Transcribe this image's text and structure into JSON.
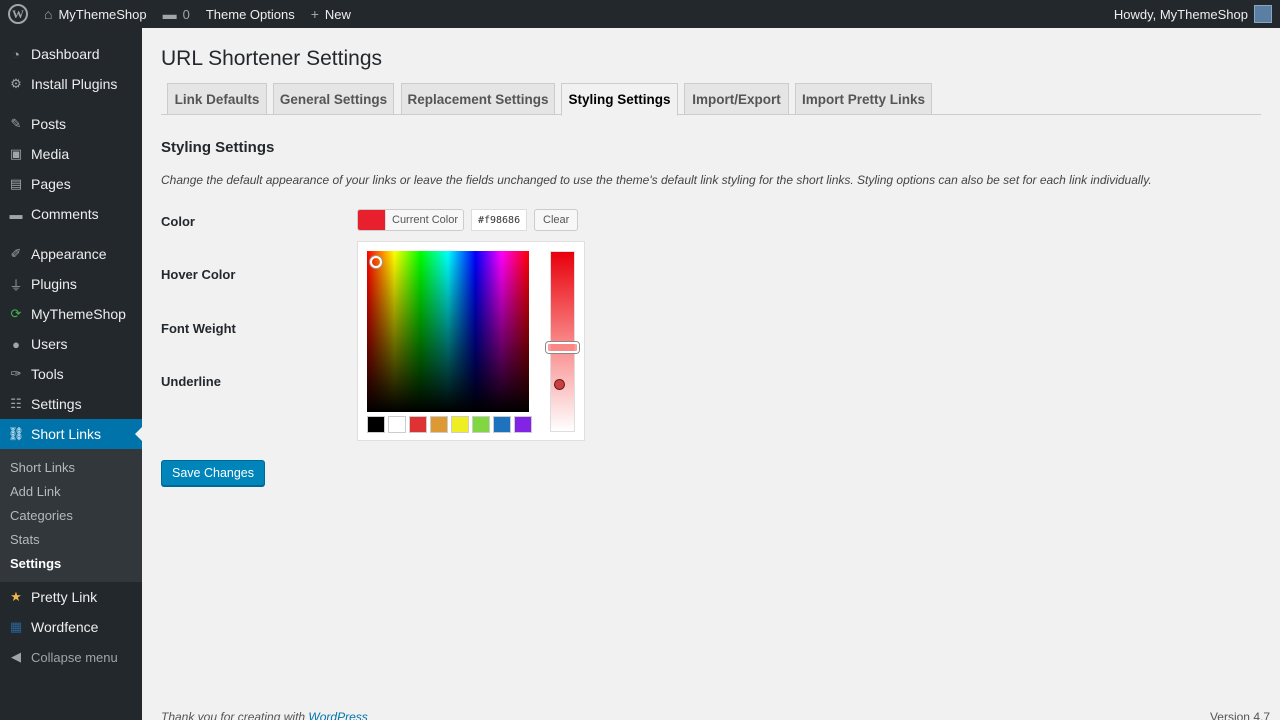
{
  "adminbar": {
    "site_name": "MyThemeShop",
    "comments_count": "0",
    "theme_options": "Theme Options",
    "new_label": "New",
    "howdy": "Howdy, MyThemeShop"
  },
  "sidebar": {
    "items": [
      {
        "label": "Dashboard",
        "icon": "dashboard-icon",
        "glyph": "◔"
      },
      {
        "label": "Install Plugins",
        "icon": "gear-icon",
        "glyph": "⚙"
      },
      {
        "label": "Posts",
        "icon": "pin-icon",
        "glyph": "✎"
      },
      {
        "label": "Media",
        "icon": "media-icon",
        "glyph": "▣"
      },
      {
        "label": "Pages",
        "icon": "pages-icon",
        "glyph": "▤"
      },
      {
        "label": "Comments",
        "icon": "comment-icon",
        "glyph": "▬"
      },
      {
        "label": "Appearance",
        "icon": "brush-icon",
        "glyph": "✐"
      },
      {
        "label": "Plugins",
        "icon": "plug-icon",
        "glyph": "⏚"
      },
      {
        "label": "MyThemeShop",
        "icon": "refresh-icon",
        "glyph": "⟳"
      },
      {
        "label": "Users",
        "icon": "user-icon",
        "glyph": "●"
      },
      {
        "label": "Tools",
        "icon": "wrench-icon",
        "glyph": "✑"
      },
      {
        "label": "Settings",
        "icon": "sliders-icon",
        "glyph": "☷"
      },
      {
        "label": "Short Links",
        "icon": "link-icon",
        "glyph": "⛓"
      }
    ],
    "submenu": [
      "Short Links",
      "Add Link",
      "Categories",
      "Stats",
      "Settings"
    ],
    "after_items": [
      {
        "label": "Pretty Link",
        "icon": "star-icon",
        "glyph": "★"
      },
      {
        "label": "Wordfence",
        "icon": "wordfence-icon",
        "glyph": "▦"
      }
    ],
    "collapse": "Collapse menu"
  },
  "page": {
    "title": "URL Shortener Settings",
    "tabs": [
      "Link Defaults",
      "General Settings",
      "Replacement Settings",
      "Styling Settings",
      "Import/Export",
      "Import Pretty Links"
    ],
    "active_tab": "Styling Settings",
    "section_title": "Styling Settings",
    "description": "Change the default appearance of your links or leave the fields unchanged to use the theme's default link styling for the short links. Styling options can also be set for each link individually.",
    "fields": [
      "Color",
      "Hover Color",
      "Font Weight",
      "Underline"
    ],
    "save_label": "Save Changes"
  },
  "color_picker": {
    "current_color_label": "Current Color",
    "hex_value": "#f98686",
    "swatch_color": "#e8202e",
    "clear_label": "Clear",
    "palette": [
      "#000000",
      "#ffffff",
      "#dd3333",
      "#dd9933",
      "#eeee22",
      "#81d742",
      "#1e73be",
      "#8224e3"
    ]
  },
  "footer": {
    "thanks_prefix": "Thank you for creating with ",
    "wordpress_link": "WordPress",
    "version": "Version 4.7"
  }
}
